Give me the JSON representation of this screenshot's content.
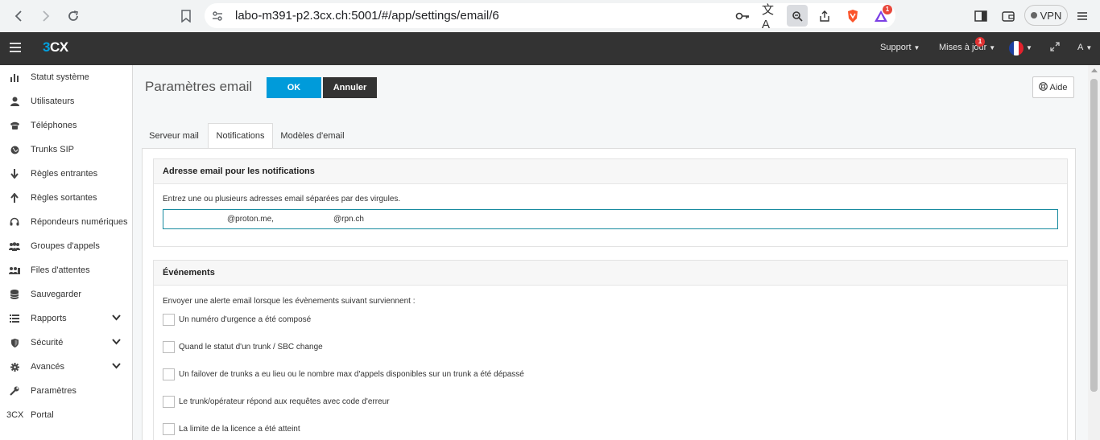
{
  "browser": {
    "url": "labo-m391-p2.3cx.ch:5001/#/app/settings/email/6",
    "vpn_label": "VPN",
    "ext_badge": "1"
  },
  "header": {
    "logo_3": "3",
    "logo_cx": "CX",
    "support": "Support",
    "updates": "Mises à jour",
    "updates_badge": "1",
    "user": "A"
  },
  "sidebar": {
    "items": [
      {
        "label": "Statut système",
        "icon": "bar-chart-icon"
      },
      {
        "label": "Utilisateurs",
        "icon": "user-icon"
      },
      {
        "label": "Téléphones",
        "icon": "phone-icon"
      },
      {
        "label": "Trunks SIP",
        "icon": "globe-icon"
      },
      {
        "label": "Règles entrantes",
        "icon": "arrow-down-icon"
      },
      {
        "label": "Règles sortantes",
        "icon": "arrow-up-icon"
      },
      {
        "label": "Répondeurs numériques",
        "icon": "headset-icon"
      },
      {
        "label": "Groupes d'appels",
        "icon": "group-icon"
      },
      {
        "label": "Files d'attentes",
        "icon": "queue-icon"
      },
      {
        "label": "Sauvegarder",
        "icon": "database-icon"
      },
      {
        "label": "Rapports",
        "icon": "list-icon"
      },
      {
        "label": "Sécurité",
        "icon": "shield-icon"
      },
      {
        "label": "Avancés",
        "icon": "gear-icon"
      },
      {
        "label": "Paramètres",
        "icon": "wrench-icon"
      },
      {
        "label": "Portal",
        "icon_text": "3CX"
      }
    ]
  },
  "main": {
    "title": "Paramètres email",
    "ok_label": "OK",
    "cancel_label": "Annuler",
    "help_label": "Aide",
    "tabs": [
      {
        "label": "Serveur mail"
      },
      {
        "label": "Notifications"
      },
      {
        "label": "Modèles d'email"
      }
    ],
    "notifications": {
      "heading": "Adresse email pour les notifications",
      "description": "Entrez une ou plusieurs adresses email séparées par des virgules.",
      "email_part1": "@proton.me,",
      "email_part2": "@rpn.ch"
    },
    "events": {
      "heading": "Événements",
      "description": "Envoyer une alerte email lorsque les évènements suivant surviennent :",
      "items": [
        {
          "label": "Un numéro d'urgence a été composé"
        },
        {
          "label": "Quand le statut d'un trunk / SBC change"
        },
        {
          "label": "Un failover de trunks a eu lieu ou le nombre max d'appels disponibles sur un trunk a été dépassé"
        },
        {
          "label": "Le trunk/opérateur répond aux requêtes avec code d'erreur"
        },
        {
          "label": "La limite de la licence a été atteint"
        }
      ]
    }
  }
}
